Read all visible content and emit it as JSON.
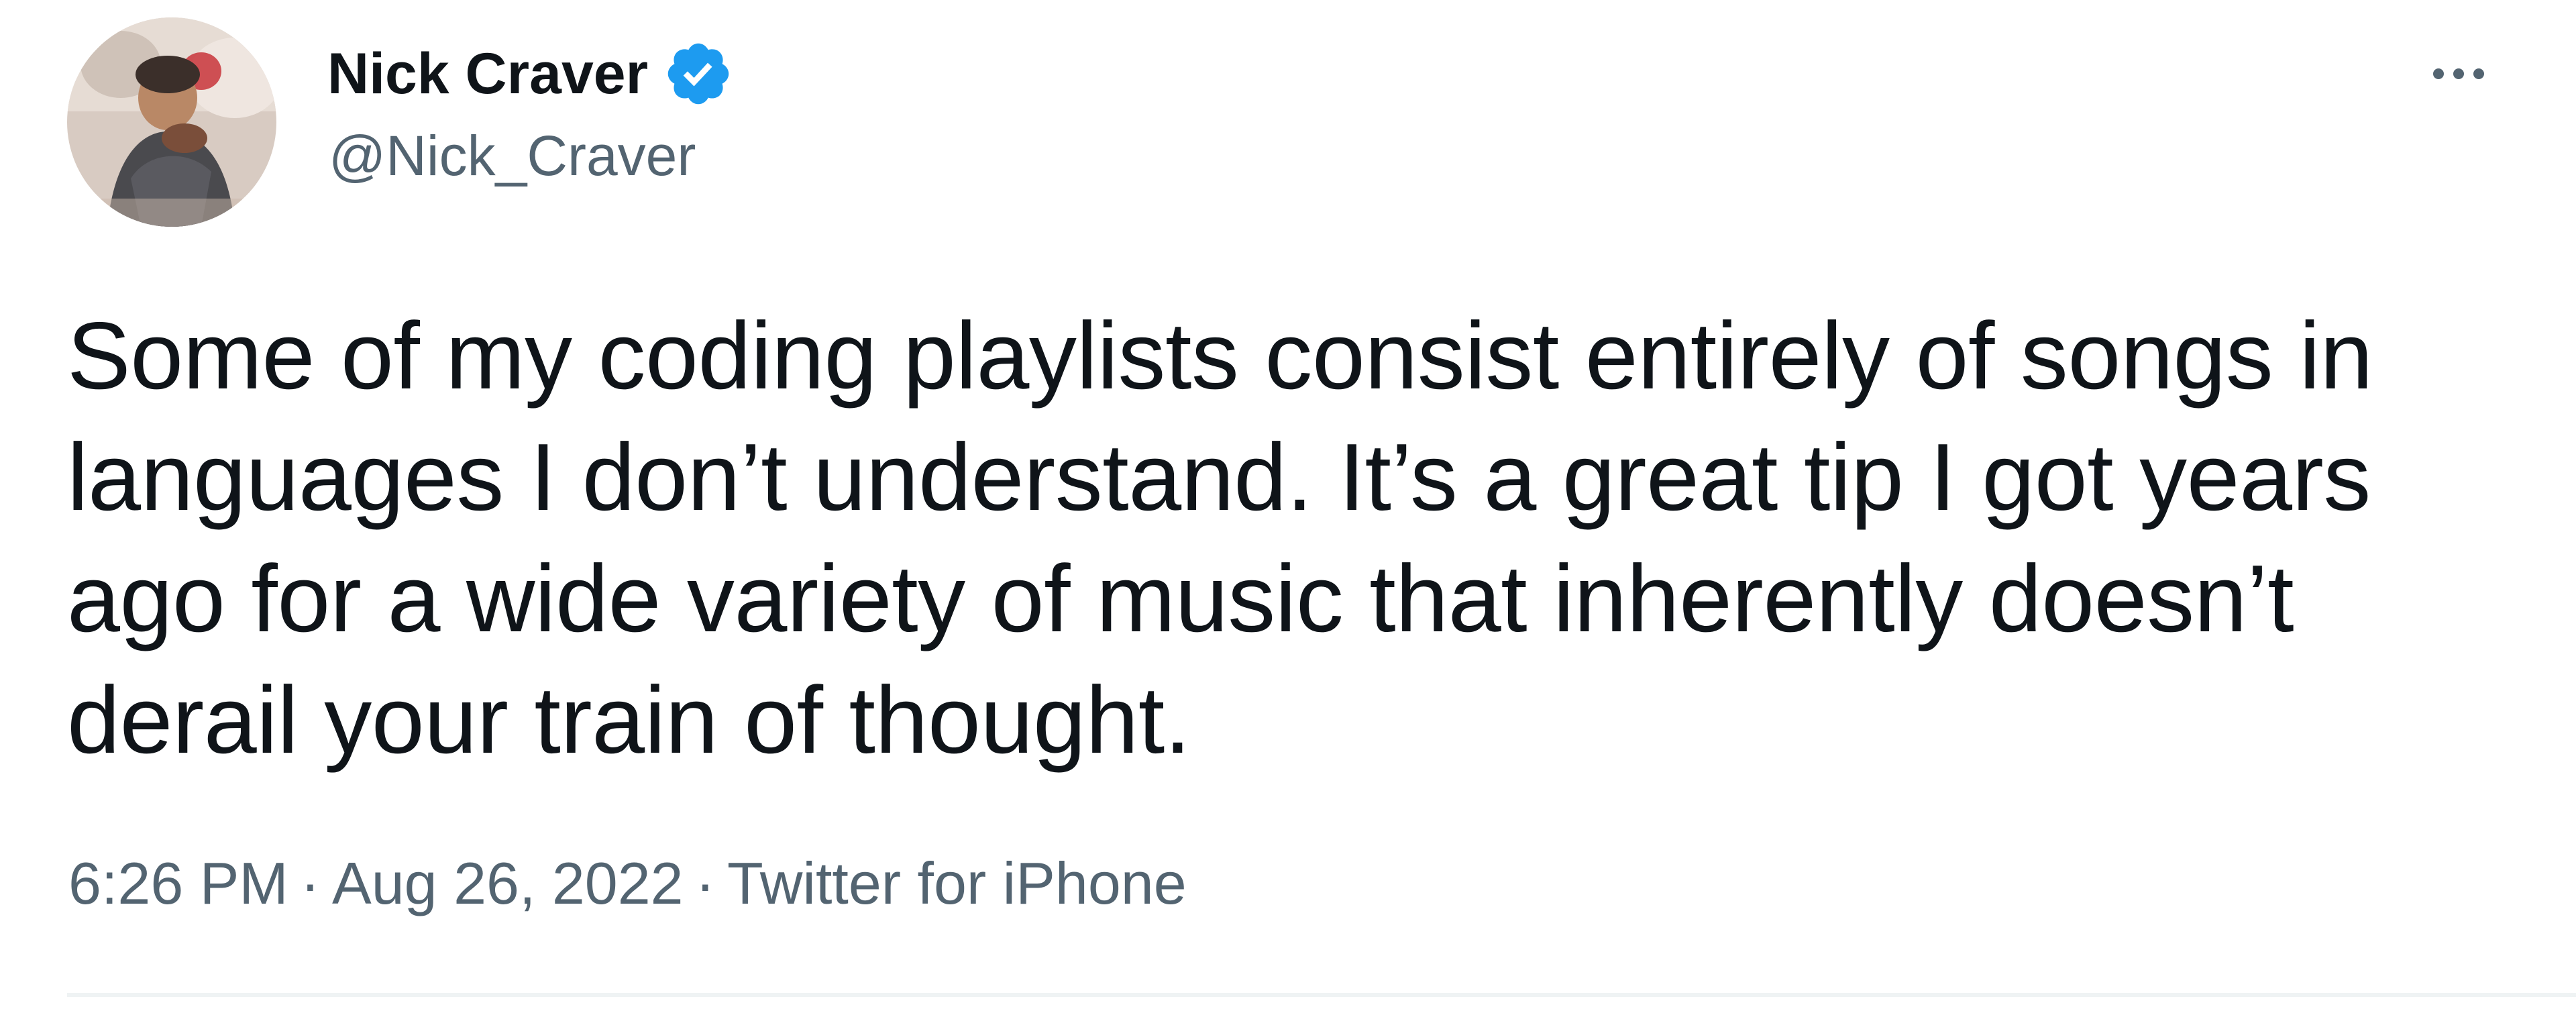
{
  "user": {
    "display_name": "Nick Craver",
    "handle": "@Nick_Craver",
    "verified": true,
    "avatar_icon": "profile-photo"
  },
  "tweet": {
    "text": "Some of my coding playlists consist entirely of songs in\nlanguages I don’t understand. It’s a great tip I got years\nago for a wide variety of music that inherently doesn’t\nderail your train of thought.",
    "time": "6:26 PM",
    "date": "Aug 26, 2022",
    "source": "Twitter for iPhone",
    "separator": "·"
  },
  "icons": {
    "verified": "verified-badge-icon",
    "more": "more-options-icon"
  },
  "colors": {
    "text_primary": "#0f1419",
    "text_secondary": "#536471",
    "verified_blue": "#1d9bf0",
    "divider": "#eff3f4"
  }
}
